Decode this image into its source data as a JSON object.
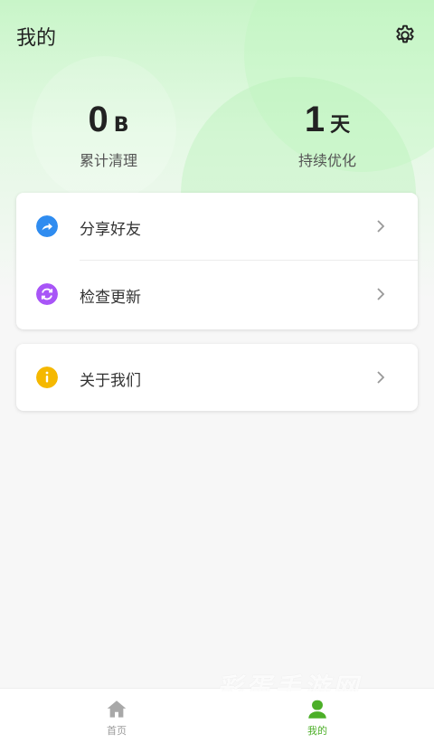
{
  "header": {
    "title": "我的",
    "settings_icon": "gear-icon"
  },
  "stats": [
    {
      "value": "0",
      "unit": "B",
      "label": "累计清理"
    },
    {
      "value": "1",
      "unit": "天",
      "label": "持续优化"
    }
  ],
  "menu": {
    "items": [
      {
        "label": "分享好友",
        "icon": "share-icon",
        "color": "#2f8cf0"
      },
      {
        "label": "检查更新",
        "icon": "refresh-icon",
        "color": "#a855f7"
      }
    ],
    "about": {
      "label": "关于我们",
      "icon": "info-icon",
      "color": "#f5b800"
    }
  },
  "tabbar": {
    "home": {
      "label": "首页",
      "icon": "home-icon",
      "color": "#9a9a9a"
    },
    "me": {
      "label": "我的",
      "icon": "person-icon",
      "color": "#4caf28"
    }
  },
  "watermark": {
    "text": "彩蛋手游网"
  }
}
